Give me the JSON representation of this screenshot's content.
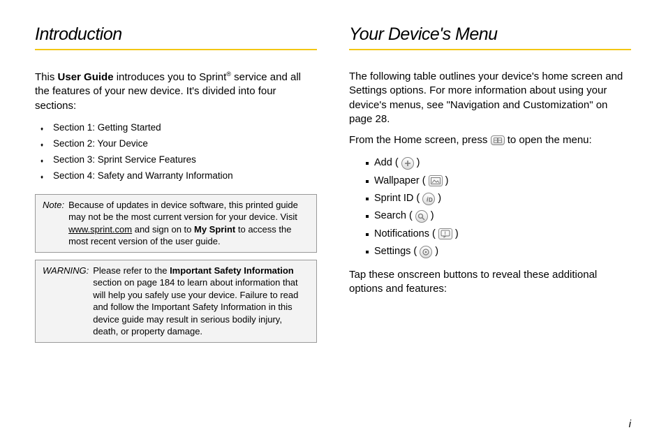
{
  "left": {
    "heading": "Introduction",
    "intro_pre": "This ",
    "intro_bold": "User Guide",
    "intro_mid": " introduces you to Sprint",
    "intro_sup": "®",
    "intro_post": " service and all the features of your new device. It's divided into four sections:",
    "sections": [
      "Section 1:  Getting Started",
      "Section 2:  Your Device",
      "Section 3:  Sprint Service Features",
      "Section 4:  Safety and Warranty Information"
    ],
    "note_label": "Note:",
    "note_pre": "Because of updates in device software, this printed guide may not be the most current version for your device. Visit ",
    "note_link": "www.sprint.com",
    "note_mid": " and sign on to ",
    "note_bold": "My Sprint",
    "note_post": " to access the most recent version of the user guide.",
    "warn_label": "WARNING:",
    "warn_pre": "Please refer to the ",
    "warn_bold": "Important Safety Information",
    "warn_post": " section on page 184 to learn about information that will help you safely use your device. Failure to read and follow the Important Safety Information in this device guide may result in serious bodily injury, death, or property damage."
  },
  "right": {
    "heading": "Your Device's Menu",
    "intro": "The following table outlines your device's home screen and Settings options. For more information about using your device's menus, see \"Navigation and Customization\" on page 28.",
    "from_pre": "From the Home screen, press ",
    "from_post": " to open the menu:",
    "items": [
      {
        "label": "Add",
        "icon": "plus-icon"
      },
      {
        "label": "Wallpaper",
        "icon": "picture-icon"
      },
      {
        "label": "Sprint ID",
        "icon": "id-icon"
      },
      {
        "label": "Search",
        "icon": "search-icon"
      },
      {
        "label": "Notifications",
        "icon": "notification-icon"
      },
      {
        "label": "Settings",
        "icon": "settings-icon"
      }
    ],
    "tap": "Tap these onscreen buttons to reveal these additional options and features:"
  },
  "pagenum": "i"
}
